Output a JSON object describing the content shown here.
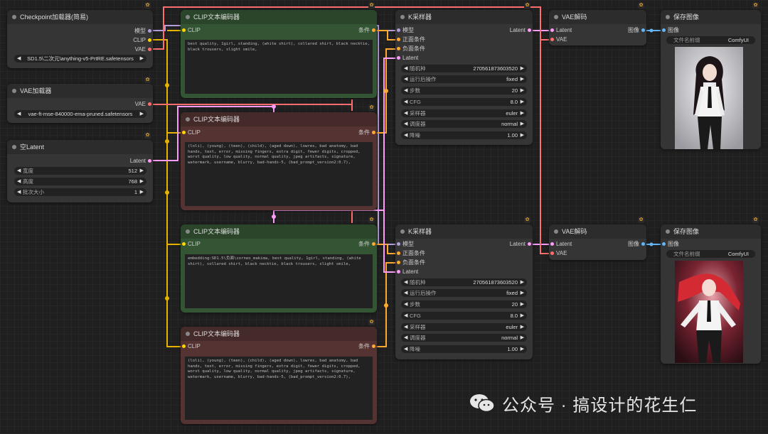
{
  "colors": {
    "clip": "#ffd500",
    "model": "#b39ddb",
    "vae": "#ff6e6e",
    "latent": "#ff9cf9",
    "cond": "#ffa931",
    "image": "#64b5f6",
    "wire_gold": "#e6b400"
  },
  "checkpoint_loader": {
    "title": "Checkpoint加载器(简易)",
    "out_model": "模型",
    "out_clip": "CLIP",
    "out_vae": "VAE",
    "ckpt_name": "SD1.5\\二次元\\anything-v5-PrtRE.safetensors"
  },
  "vae_loader": {
    "title": "VAE加载器",
    "out_vae": "VAE",
    "vae_name": "vae-ft-mse-840000-ema-pruned.safetensors"
  },
  "empty_latent": {
    "title": "空Latent",
    "out_latent": "Latent",
    "width_label": "宽度",
    "width": "512",
    "height_label": "高度",
    "height": "768",
    "batch_label": "批次大小",
    "batch": "1"
  },
  "clip_pos_1": {
    "title": "CLIP文本编码器",
    "in_clip": "CLIP",
    "out_cond": "条件",
    "text": "best quality, 1girl, standing, (white shirt), collared shirt, black necktie, black trousers, slight smile,"
  },
  "clip_neg_1": {
    "title": "CLIP文本编码器",
    "in_clip": "CLIP",
    "out_cond": "条件",
    "text": "(loli), (young), (teen), (child), (aged down), lowres, bad anatomy, bad hands, text, error, missing fingers, extra digit, fewer digits, cropped, worst quality, low quality, normal quality, jpeg artifacts, signature, watermark, username, blurry, bad-hands-5, (bad_prompt_version2:0.7),"
  },
  "clip_pos_2": {
    "title": "CLIP文本编码器",
    "in_clip": "CLIP",
    "out_cond": "条件",
    "text": "embedding:SD1.5\\负面\\corneo_makima, best quality, 1girl, standing, (white shirt), collared shirt, black necktie, black trousers, slight smile,"
  },
  "clip_neg_2": {
    "title": "CLIP文本编码器",
    "in_clip": "CLIP",
    "out_cond": "条件",
    "text": "(loli), (young), (teen), (child), (aged down), lowres, bad anatomy, bad hands, text, error, missing fingers, extra digit, fewer digits, cropped, worst quality, low quality, normal quality, jpeg artifacts, signature, watermark, username, blurry, bad-hands-5, (bad_prompt_version2:0.7),"
  },
  "ksampler_1": {
    "title": "K采样器",
    "in_model": "模型",
    "in_pos": "正面条件",
    "in_neg": "负面条件",
    "in_latent": "Latent",
    "out_latent": "Latent",
    "seed_label": "随机种",
    "seed": "270561873603520",
    "control_label": "运行后操作",
    "control": "fixed",
    "steps_label": "步数",
    "steps": "20",
    "cfg_label": "CFG",
    "cfg": "8.0",
    "sampler_label": "采样器",
    "sampler": "euler",
    "scheduler_label": "调度器",
    "scheduler": "normal",
    "denoise_label": "降噪",
    "denoise": "1.00"
  },
  "ksampler_2": {
    "title": "K采样器",
    "in_model": "模型",
    "in_pos": "正面条件",
    "in_neg": "负面条件",
    "in_latent": "Latent",
    "out_latent": "Latent",
    "seed_label": "随机种",
    "seed": "270561873603520",
    "control_label": "运行后操作",
    "control": "fixed",
    "steps_label": "步数",
    "steps": "20",
    "cfg_label": "CFG",
    "cfg": "8.0",
    "sampler_label": "采样器",
    "sampler": "euler",
    "scheduler_label": "调度器",
    "scheduler": "normal",
    "denoise_label": "降噪",
    "denoise": "1.00"
  },
  "vae_decode_1": {
    "title": "VAE解码",
    "in_latent": "Latent",
    "in_vae": "VAE",
    "out_image": "图像"
  },
  "vae_decode_2": {
    "title": "VAE解码",
    "in_latent": "Latent",
    "in_vae": "VAE",
    "out_image": "图像"
  },
  "save_image_1": {
    "title": "保存图像",
    "in_image": "图像",
    "prefix_label": "文件名前缀",
    "prefix": "ComfyUI"
  },
  "save_image_2": {
    "title": "保存图像",
    "in_image": "图像",
    "prefix_label": "文件名前缀",
    "prefix": "ComfyUI"
  },
  "watermark": {
    "text": "公众号 · 搞设计的花生仁"
  }
}
